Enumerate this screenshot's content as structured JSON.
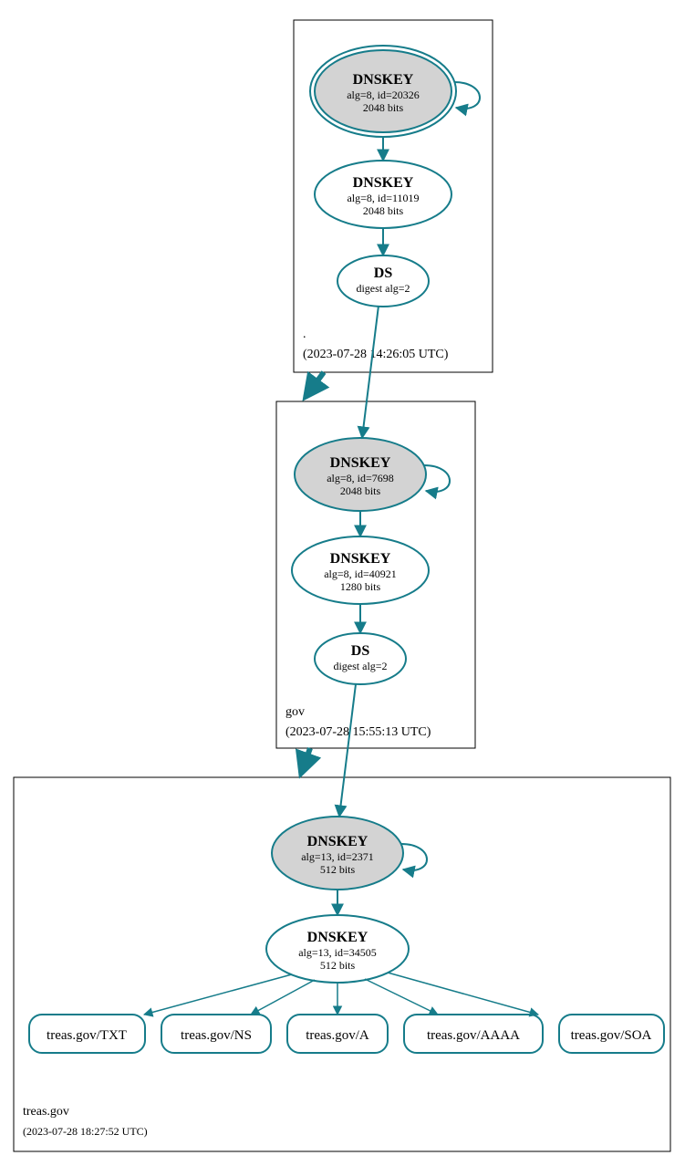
{
  "color": "#167c8a",
  "zones": [
    {
      "name": ".",
      "timestamp": "(2023-07-28 14:26:05 UTC)",
      "nodes": [
        {
          "id": "root-ksk",
          "type": "ksk-trusted",
          "title": "DNSKEY",
          "line2": "alg=8, id=20326",
          "line3": "2048 bits"
        },
        {
          "id": "root-zsk",
          "type": "dnskey",
          "title": "DNSKEY",
          "line2": "alg=8, id=11019",
          "line3": "2048 bits"
        },
        {
          "id": "root-ds",
          "type": "ds",
          "title": "DS",
          "line2": "digest alg=2"
        }
      ]
    },
    {
      "name": "gov",
      "timestamp": "(2023-07-28 15:55:13 UTC)",
      "nodes": [
        {
          "id": "gov-ksk",
          "type": "ksk",
          "title": "DNSKEY",
          "line2": "alg=8, id=7698",
          "line3": "2048 bits"
        },
        {
          "id": "gov-zsk",
          "type": "dnskey",
          "title": "DNSKEY",
          "line2": "alg=8, id=40921",
          "line3": "1280 bits"
        },
        {
          "id": "gov-ds",
          "type": "ds",
          "title": "DS",
          "line2": "digest alg=2"
        }
      ]
    },
    {
      "name": "treas.gov",
      "timestamp": "(2023-07-28 18:27:52 UTC)",
      "nodes": [
        {
          "id": "treas-ksk",
          "type": "ksk",
          "title": "DNSKEY",
          "line2": "alg=13, id=2371",
          "line3": "512 bits"
        },
        {
          "id": "treas-zsk",
          "type": "dnskey",
          "title": "DNSKEY",
          "line2": "alg=13, id=34505",
          "line3": "512 bits"
        }
      ],
      "records": [
        "treas.gov/TXT",
        "treas.gov/NS",
        "treas.gov/A",
        "treas.gov/AAAA",
        "treas.gov/SOA"
      ]
    }
  ]
}
